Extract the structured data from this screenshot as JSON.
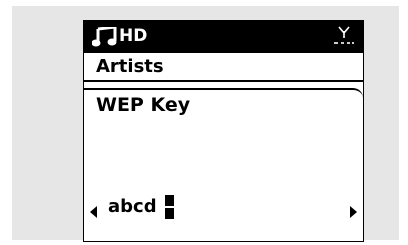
{
  "statusbar": {
    "source_label": "HD",
    "left_icon": "music-note-icon",
    "right_icon": "wifi-signal-icon"
  },
  "menu": {
    "breadcrumb": "Artists"
  },
  "panel": {
    "title": "WEP Key",
    "entry_value": "abcd",
    "left_arrow_icon": "arrow-left-icon",
    "right_arrow_icon": "arrow-right-icon"
  },
  "colors": {
    "screen_bg": "#ffffff",
    "frame_bg": "#e6e6e6",
    "ink": "#000000"
  }
}
